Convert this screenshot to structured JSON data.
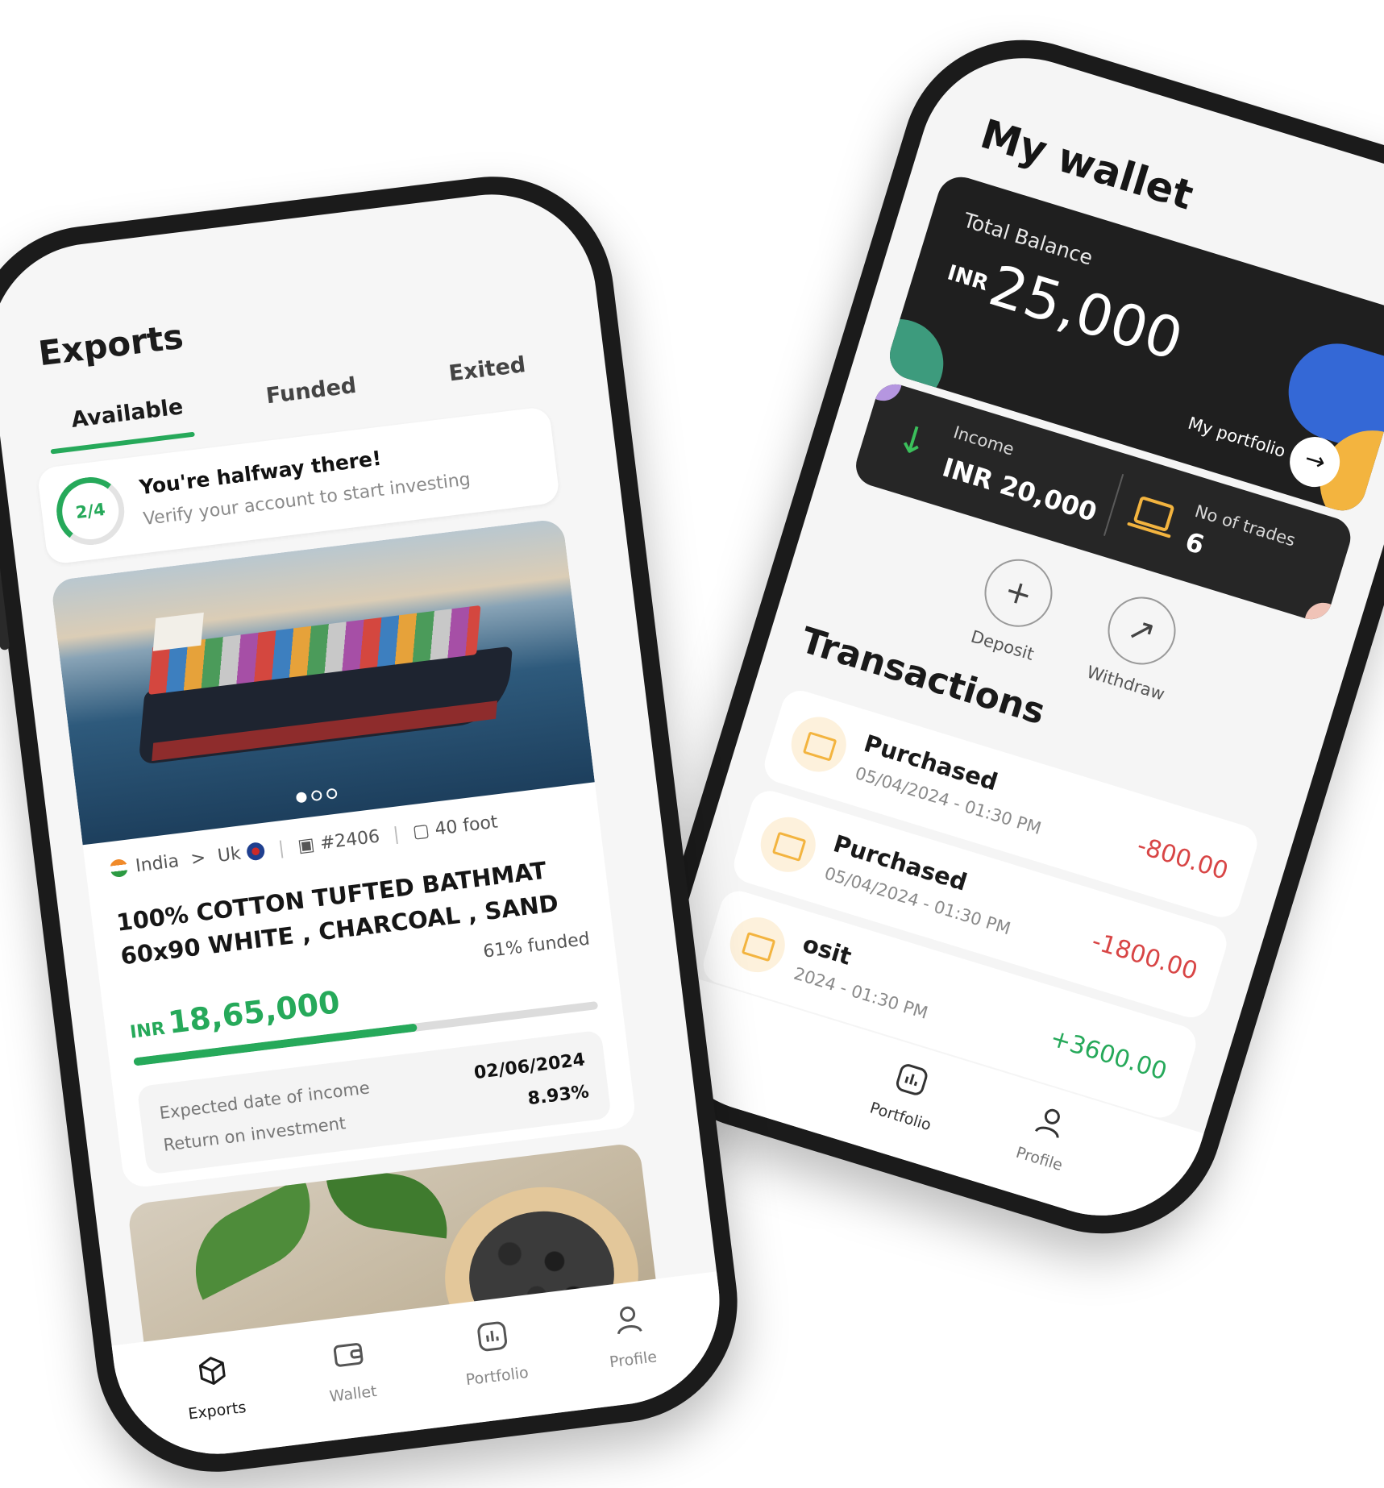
{
  "wallet_screen": {
    "title": "My wallet",
    "balance": {
      "label": "Total Balance",
      "currency": "INR",
      "amount": "25,000",
      "portfolio_label": "My portfolio",
      "portfolio_arrow": "→"
    },
    "income": {
      "icon": "↓",
      "label": "Income",
      "value": "INR 20,000"
    },
    "trades": {
      "label": "No of trades",
      "value": "6"
    },
    "actions": [
      {
        "label": "Deposit",
        "icon": "+"
      },
      {
        "label": "Withdraw",
        "icon": "↗"
      }
    ],
    "transactions_title": "Transactions",
    "filter_icon": "⚟",
    "transactions": [
      {
        "name": "Purchased",
        "date": "05/04/2024 - 01:30 PM",
        "amount": "-800.00"
      },
      {
        "name": "Purchased",
        "date": "05/04/2024 - 01:30 PM",
        "amount": "-1800.00"
      },
      {
        "name": "osit",
        "date": "2024 - 01:30 PM",
        "amount": "+3600.00"
      }
    ],
    "nav": [
      {
        "label": "Portfolio",
        "icon": "chart-icon"
      },
      {
        "label": "Profile",
        "icon": "user-icon"
      }
    ],
    "colors": {
      "card": "#1f1f1f",
      "blue": "#3468d6",
      "yellow": "#f3b43f",
      "teal": "#3d9b7d",
      "negative": "#d84545",
      "positive": "#26a95a"
    }
  },
  "exports_screen": {
    "title": "Exports",
    "tabs": [
      "Available",
      "Funded",
      "Exited"
    ],
    "active_tab": "Available",
    "verify": {
      "progress": "2/4",
      "heading": "You're halfway there!",
      "subtext": "Verify your account to start investing"
    },
    "product": {
      "origin": "India",
      "arrow": ">",
      "destination": "Uk",
      "id": "#2406",
      "container": "40 foot",
      "title": "100% COTTON TUFTED BATHMAT 60x90 WHITE , CHARCOAL , SAND",
      "funded_label": "61% funded",
      "funded_fraction": 0.61,
      "currency": "INR",
      "price": "18,65,000",
      "expected_label": "Expected date of income",
      "expected_value": "02/06/2024",
      "roi_label": "Return on investment",
      "roi_value": "8.93%"
    },
    "nav": [
      {
        "label": "Exports",
        "icon": "cube-icon"
      },
      {
        "label": "Wallet",
        "icon": "wallet-icon"
      },
      {
        "label": "Portfolio",
        "icon": "chart-icon"
      },
      {
        "label": "Profile",
        "icon": "user-icon"
      }
    ],
    "colors": {
      "accent": "#26a95a"
    }
  }
}
